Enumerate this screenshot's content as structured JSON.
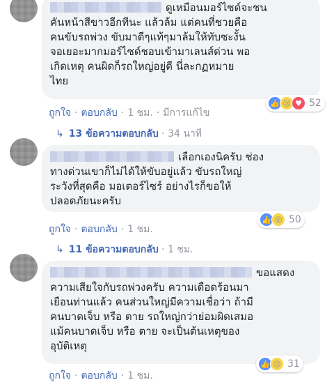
{
  "comments": [
    {
      "lines": [
        "ดูเหมือนมอร์ไซด์จะชน",
        "คันหน้าสีขาวอีกทีนะ แล้วล้ม แต่คนที่ชวยคือ",
        "คนขับรถพ่วง ขับมาดีๆแท้ๆมาล้มให้ทับซะงั้น",
        "จอเยอะมากมอร์ไซด์ชอบเข้ามาเลนส์ด่วน พอ",
        "เกิดเหตุ คนผิดก็รถใหญ่อยู่ดี นี่ละกฏหมาย",
        "ไทย"
      ],
      "meta": {
        "like": "ถูกใจ",
        "reply": "ตอบกลับ",
        "time": "1 ชม.",
        "edited": "มีการแก้ไข"
      },
      "reactions": {
        "count": "52"
      },
      "replies": {
        "label": "13 ข้อความตอบกลับ",
        "time": "34 นาที"
      }
    },
    {
      "lines": [
        "เลือกเองนิครับ ช่อง",
        "ทางด่วนเขาก็ไม่ได้ให้ขับอยู่แล้ว ขับรถใหญ่",
        "ระวังที่สุดคือ มอเตอร์ไซร์ อย่างไรก็ขอให้",
        "ปลอดภัยนะครับ"
      ],
      "meta": {
        "like": "ถูกใจ",
        "reply": "ตอบกลับ",
        "time": "1 ชม."
      },
      "reactions": {
        "count": "50"
      },
      "replies": {
        "label": "11 ข้อความตอบกลับ",
        "time": "1 ชม."
      }
    },
    {
      "lines": [
        "ขอแสดง",
        "ความเสียใจกับรถพ่วงครับ ความเดือดร้อนมา",
        "เยือนท่านแล้ว คนส่วนใหญ่มีความเชื่อว่า ถ้ามี",
        "คนบาดเจ็บ หรือ ตาย รถใหญ่กว่าย่อมผิดเสมอ",
        "แม้คนบาดเจ็บ หรือ ตาย จะเป็นต้นเหตุของ",
        "อุบัติเหตุ"
      ],
      "meta": {
        "like": "ถูกใจ",
        "reply": "ตอบกลับ",
        "time": "1 ชม."
      },
      "reactions": {
        "count": "31"
      }
    }
  ]
}
